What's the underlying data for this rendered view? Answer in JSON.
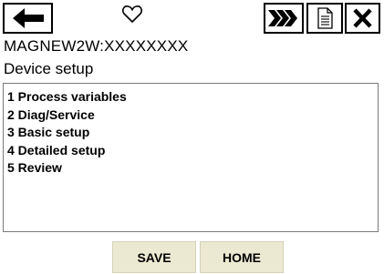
{
  "toolbar": {
    "back_icon": "arrow-left-icon",
    "status_icon": "heart-icon",
    "forward_icon": "double-chevron-right-icon",
    "document_icon": "document-icon",
    "close_icon": "close-x-icon"
  },
  "device_id": "MAGNEW2W:XXXXXXXX",
  "screen_title": "Device setup",
  "menu": {
    "items": [
      {
        "label": "1 Process variables"
      },
      {
        "label": "2 Diag/Service"
      },
      {
        "label": "3 Basic setup"
      },
      {
        "label": "4 Detailed setup"
      },
      {
        "label": "5 Review"
      }
    ]
  },
  "buttons": {
    "save_label": "SAVE",
    "home_label": "HOME"
  },
  "colors": {
    "button_bg": "#ece9d2",
    "list_border": "#7a7a7a"
  }
}
